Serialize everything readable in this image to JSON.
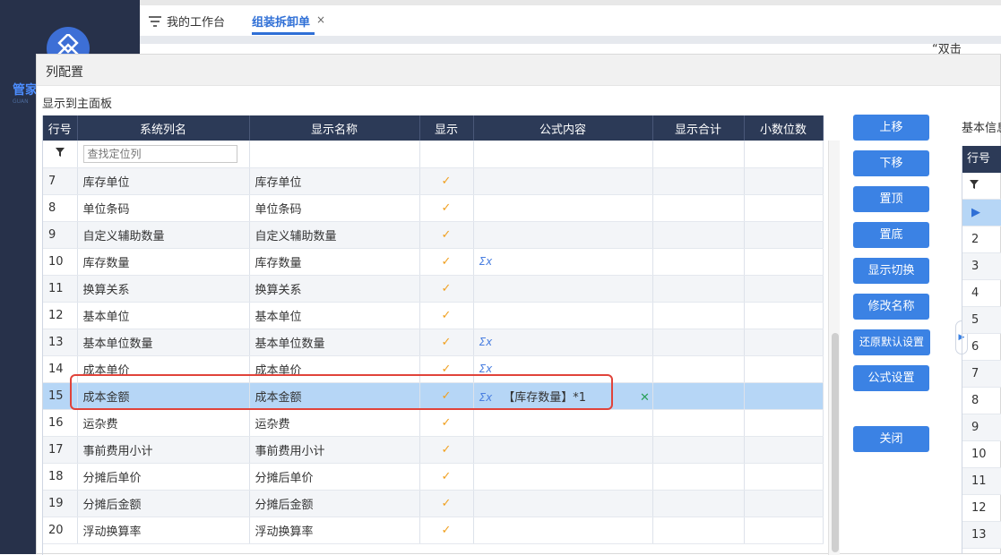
{
  "sidebar": {
    "brand": "管家",
    "brand_sub": "GUAN"
  },
  "tabs": [
    {
      "label": "我的工作台"
    },
    {
      "label": "组装拆卸单"
    }
  ],
  "tab_close": "×",
  "modal": {
    "title": "列配置",
    "section_title": "显示到主面板",
    "hint": "“双击",
    "columns": [
      "行号",
      "系统列名",
      "显示名称",
      "显示",
      "公式内容",
      "显示合计",
      "小数位数"
    ],
    "filter_placeholder": "查找定位列",
    "rows": [
      {
        "no": "7",
        "sys": "库存单位",
        "name": "库存单位",
        "show": "✓",
        "formula": ""
      },
      {
        "no": "8",
        "sys": "单位条码",
        "name": "单位条码",
        "show": "✓",
        "formula": ""
      },
      {
        "no": "9",
        "sys": "自定义辅助数量",
        "name": "自定义辅助数量",
        "show": "✓",
        "formula": ""
      },
      {
        "no": "10",
        "sys": "库存数量",
        "name": "库存数量",
        "show": "✓",
        "formula": "Σx"
      },
      {
        "no": "11",
        "sys": "换算关系",
        "name": "换算关系",
        "show": "✓",
        "formula": ""
      },
      {
        "no": "12",
        "sys": "基本单位",
        "name": "基本单位",
        "show": "✓",
        "formula": ""
      },
      {
        "no": "13",
        "sys": "基本单位数量",
        "name": "基本单位数量",
        "show": "✓",
        "formula": "Σx"
      },
      {
        "no": "14",
        "sys": "成本单价",
        "name": "成本单价",
        "show": "✓",
        "formula": "Σx"
      },
      {
        "no": "15",
        "sys": "成本金额",
        "name": "成本金额",
        "show": "✓",
        "formula": "Σx",
        "formula_text": "【库存数量】*1",
        "clear": "✕"
      },
      {
        "no": "16",
        "sys": "运杂费",
        "name": "运杂费",
        "show": "✓",
        "formula": ""
      },
      {
        "no": "17",
        "sys": "事前费用小计",
        "name": "事前费用小计",
        "show": "✓",
        "formula": ""
      },
      {
        "no": "18",
        "sys": "分摊后单价",
        "name": "分摊后单价",
        "show": "✓",
        "formula": ""
      },
      {
        "no": "19",
        "sys": "分摊后金额",
        "name": "分摊后金额",
        "show": "✓",
        "formula": ""
      },
      {
        "no": "20",
        "sys": "浮动换算率",
        "name": "浮动换算率",
        "show": "✓",
        "formula": ""
      }
    ],
    "buttons": {
      "move_up": "上移",
      "move_down": "下移",
      "top": "置顶",
      "bottom": "置底",
      "toggle": "显示切换",
      "rename": "修改名称",
      "reset": "还原默认设置",
      "formula": "公式设置",
      "close": "关闭"
    },
    "right_panel": {
      "label": "基本信息",
      "header": "行号",
      "rows": [
        "2",
        "3",
        "4",
        "5",
        "6",
        "7",
        "8",
        "9",
        "10",
        "11",
        "12",
        "13"
      ]
    }
  },
  "colors": {
    "accent": "#3b82e4",
    "header": "#2c3a57",
    "selected": "#b6d6f6",
    "check": "#f0a020"
  }
}
